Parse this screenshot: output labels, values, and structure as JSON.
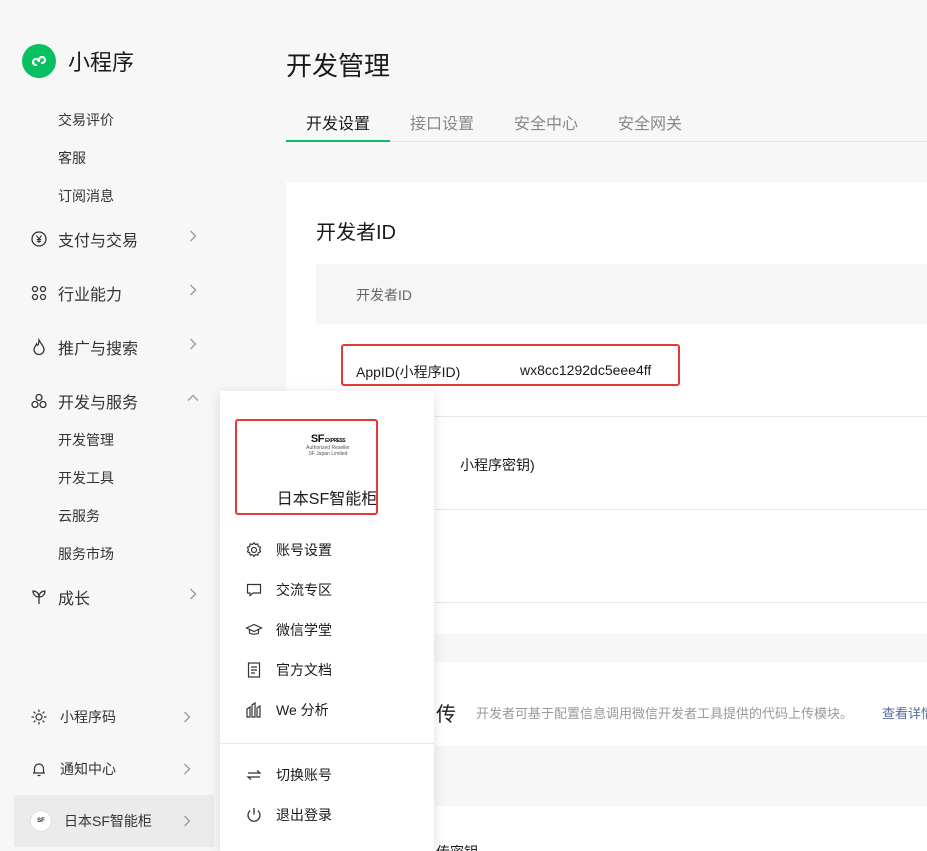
{
  "app": {
    "title": "小程序"
  },
  "sidebar": {
    "sub_items_top": [
      "交易评价",
      "客服",
      "订阅消息"
    ],
    "nav": [
      {
        "label": "支付与交易",
        "icon": "yen-circle-icon"
      },
      {
        "label": "行业能力",
        "icon": "nodes-icon"
      },
      {
        "label": "推广与搜索",
        "icon": "flame-icon"
      },
      {
        "label": "开发与服务",
        "icon": "cluster-icon"
      }
    ],
    "dev_sub_items": [
      "开发管理",
      "开发工具",
      "云服务",
      "服务市场"
    ],
    "growth": {
      "label": "成长",
      "icon": "plant-icon"
    },
    "bottom": [
      {
        "label": "小程序码",
        "icon": "sun-icon"
      },
      {
        "label": "通知中心",
        "icon": "bell-icon"
      },
      {
        "label": "日本SF智能柜",
        "icon": "avatar"
      }
    ]
  },
  "main": {
    "title": "开发管理",
    "tabs": [
      "开发设置",
      "接口设置",
      "安全中心",
      "安全网关"
    ],
    "developer_card": {
      "title": "开发者ID",
      "header": "开发者ID",
      "rows": [
        {
          "label": "AppID(小程序ID)",
          "value": "wx8cc1292dc5eee4ff"
        },
        {
          "label": "小程序密钥)",
          "value": ""
        }
      ]
    },
    "upload_card": {
      "title": "传",
      "desc": "开发者可基于配置信息调用微信开发者工具提供的代码上传模块。",
      "link": "查看详情",
      "bottom_text": "传密钥"
    }
  },
  "popup": {
    "logo_text": "SF",
    "logo_sub": "EXPRESS",
    "logo_line1": "Authorized Reseller",
    "logo_line2": "SF Japan Limited",
    "account_name": "日本SF智能柜",
    "menu": [
      {
        "label": "账号设置",
        "icon": "gear-icon"
      },
      {
        "label": "交流专区",
        "icon": "chat-bubble-icon"
      },
      {
        "label": "微信学堂",
        "icon": "graduation-cap-icon"
      },
      {
        "label": "官方文档",
        "icon": "document-icon"
      },
      {
        "label": "We 分析",
        "icon": "analytics-icon"
      }
    ],
    "menu_bottom": [
      {
        "label": "切换账号",
        "icon": "switch-icon"
      },
      {
        "label": "退出登录",
        "icon": "power-icon"
      }
    ]
  },
  "colors": {
    "accent": "#07c160",
    "highlight": "#e53935",
    "link": "#576b95"
  }
}
